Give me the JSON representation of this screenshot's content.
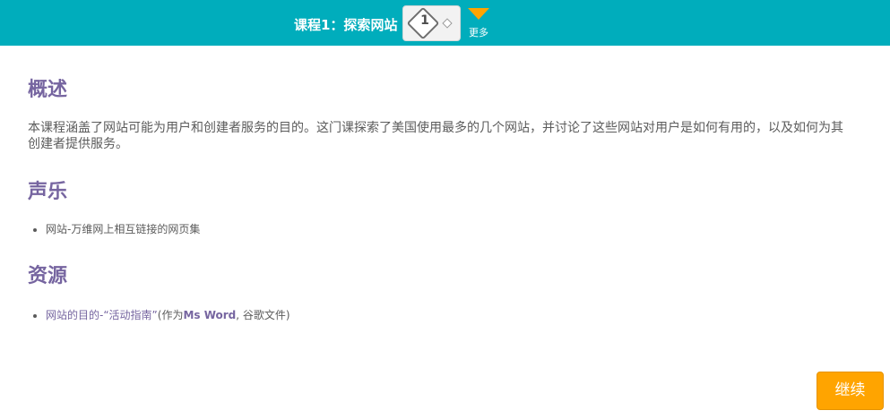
{
  "header": {
    "lesson_title": "课程1：探索网站",
    "stage_number": "1",
    "more_label": "更多"
  },
  "overview": {
    "heading": "概述",
    "text": "本课程涵盖了网站可能为用户和创建者服务的目的。这门课探索了美国使用最多的几个网站，并讨论了这些网站对用户是如何有用的，以及如何为其创建者提供服务。"
  },
  "vocabulary": {
    "heading": "声乐",
    "items": [
      "网站-万维网上相互链接的网页集"
    ]
  },
  "resources": {
    "heading": "资源",
    "item_link": "网站的目的-“活动指南”",
    "item_prefix": "(作为",
    "item_bold": "Ms Word",
    "item_suffix": ", 谷歌文件)"
  },
  "footer": {
    "continue_label": "继续"
  },
  "colors": {
    "header_bg": "#00adbc",
    "heading": "#7665a0",
    "accent": "#ffa400"
  }
}
